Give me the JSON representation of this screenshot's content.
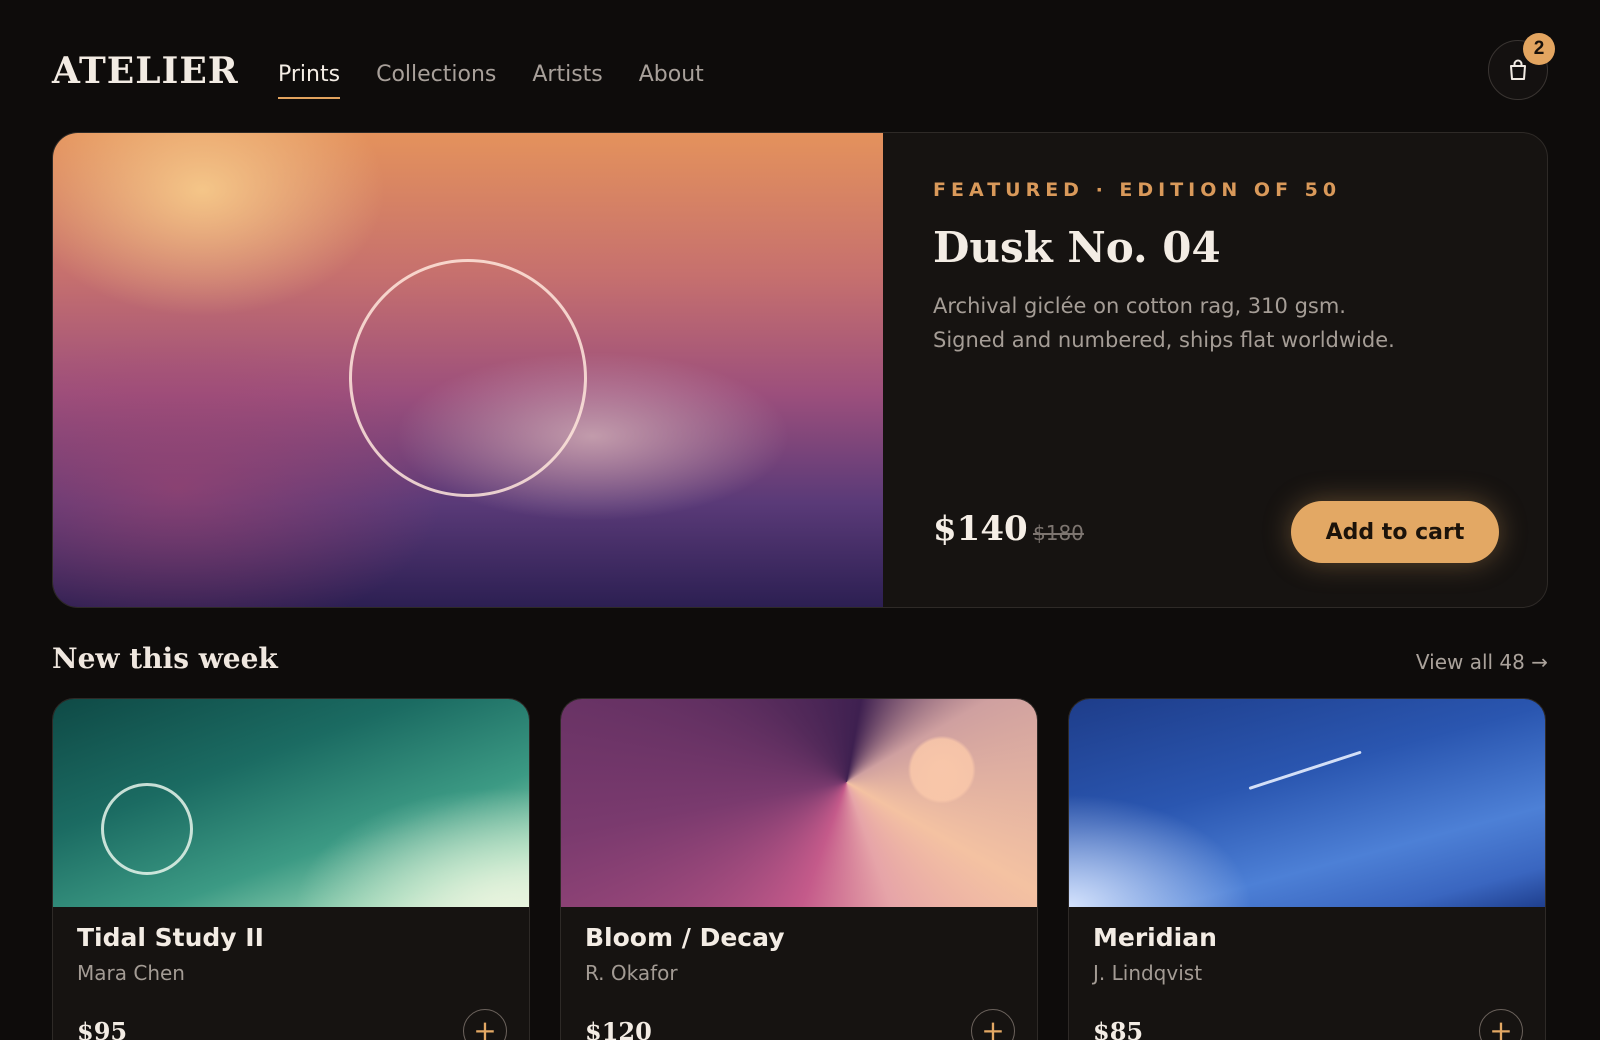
{
  "header": {
    "logo": "ATELIER",
    "nav": [
      {
        "label": "Prints",
        "active": true
      },
      {
        "label": "Collections",
        "active": false
      },
      {
        "label": "Artists",
        "active": false
      },
      {
        "label": "About",
        "active": false
      }
    ],
    "cart_icon": "shopping-bag-icon",
    "cart_count": "2"
  },
  "hero": {
    "eyebrow": "FEATURED · EDITION OF 50",
    "title": "Dusk No. 04",
    "description": "Archival giclée on cotton rag, 310 gsm. Signed and numbered, ships flat worldwide.",
    "price": "$140",
    "old_price": "$180",
    "cta_label": "Add to cart"
  },
  "section": {
    "title": "New this week",
    "view_all": "View all 48 →"
  },
  "cards": [
    {
      "title": "Tidal Study II",
      "artist": "Mara Chen",
      "price": "$95",
      "add_icon": "+"
    },
    {
      "title": "Bloom / Decay",
      "artist": "R. Okafor",
      "price": "$120",
      "add_icon": "+"
    },
    {
      "title": "Meridian",
      "artist": "J. Lindqvist",
      "price": "$85",
      "add_icon": "+"
    }
  ],
  "colors": {
    "background": "#0e0c0b",
    "accent": "#e3a864",
    "eyebrow": "#d9995a",
    "card_surface": "#161311"
  }
}
